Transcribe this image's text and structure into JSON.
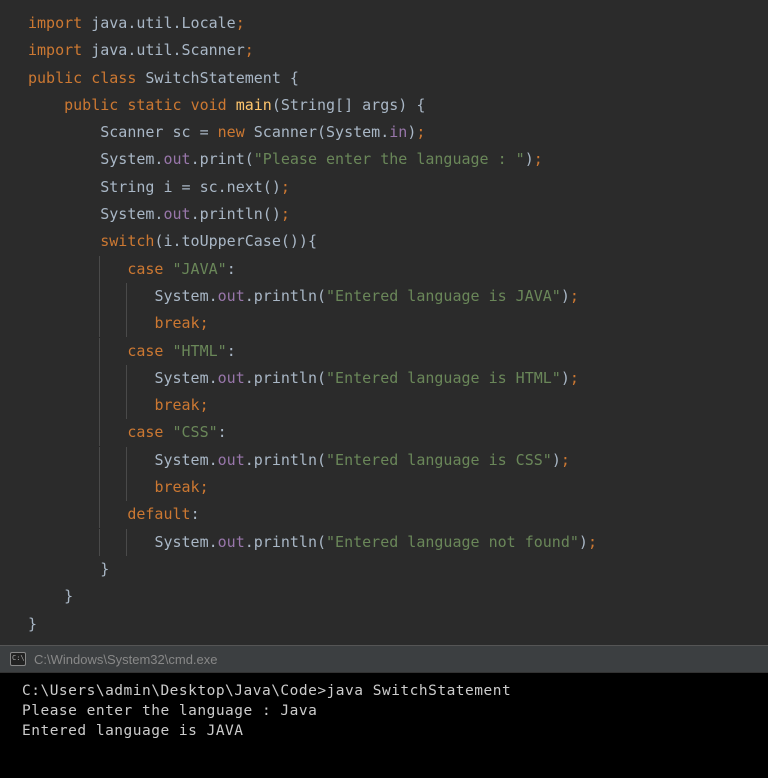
{
  "code": {
    "l1_import": "import",
    "l1_pkg": " java.util.Locale",
    "l1_semi": ";",
    "l2_import": "import",
    "l2_pkg": " java.util.Scanner",
    "l2_semi": ";",
    "l3_pub": "public ",
    "l3_class": "class ",
    "l3_name": "SwitchStatement ",
    "l3_brace": "{",
    "l4_pub": "public ",
    "l4_static": "static ",
    "l4_void": "void ",
    "l4_main": "main",
    "l4_args": "(String[] args) {",
    "l5_a": "Scanner sc = ",
    "l5_new": "new ",
    "l5_b": "Scanner(System.",
    "l5_in": "in",
    "l5_c": ")",
    "l5_semi": ";",
    "l6_a": "System.",
    "l6_out": "out",
    "l6_b": ".print(",
    "l6_str": "\"Please enter the language : \"",
    "l6_c": ")",
    "l6_semi": ";",
    "l7_a": "String i = sc.next()",
    "l7_semi": ";",
    "l8_a": "System.",
    "l8_out": "out",
    "l8_b": ".println()",
    "l8_semi": ";",
    "l9_switch": "switch",
    "l9_a": "(i.toUpperCase()){",
    "l10_case": "case ",
    "l10_str": "\"JAVA\"",
    "l10_colon": ":",
    "l11_a": "System.",
    "l11_out": "out",
    "l11_b": ".println(",
    "l11_str": "\"Entered language is JAVA\"",
    "l11_c": ")",
    "l11_semi": ";",
    "l12_break": "break",
    "l12_semi": ";",
    "l13_case": "case ",
    "l13_str": "\"HTML\"",
    "l13_colon": ":",
    "l14_a": "System.",
    "l14_out": "out",
    "l14_b": ".println(",
    "l14_str": "\"Entered language is HTML\"",
    "l14_c": ")",
    "l14_semi": ";",
    "l15_break": "break",
    "l15_semi": ";",
    "l16_case": "case ",
    "l16_str": "\"CSS\"",
    "l16_colon": ":",
    "l17_a": "System.",
    "l17_out": "out",
    "l17_b": ".println(",
    "l17_str": "\"Entered language is CSS\"",
    "l17_c": ")",
    "l17_semi": ";",
    "l18_break": "break",
    "l18_semi": ";",
    "l19_default": "default",
    "l19_colon": ":",
    "l20_a": "System.",
    "l20_out": "out",
    "l20_b": ".println(",
    "l20_str": "\"Entered language not found\"",
    "l20_c": ")",
    "l20_semi": ";",
    "l21_brace": "}",
    "l22_brace": "}",
    "l23_brace": "}"
  },
  "terminal": {
    "title": "C:\\Windows\\System32\\cmd.exe",
    "line1": "C:\\Users\\admin\\Desktop\\Java\\Code>java SwitchStatement",
    "line2": "Please enter the language : Java",
    "line3": "",
    "line4": "Entered language is JAVA"
  }
}
